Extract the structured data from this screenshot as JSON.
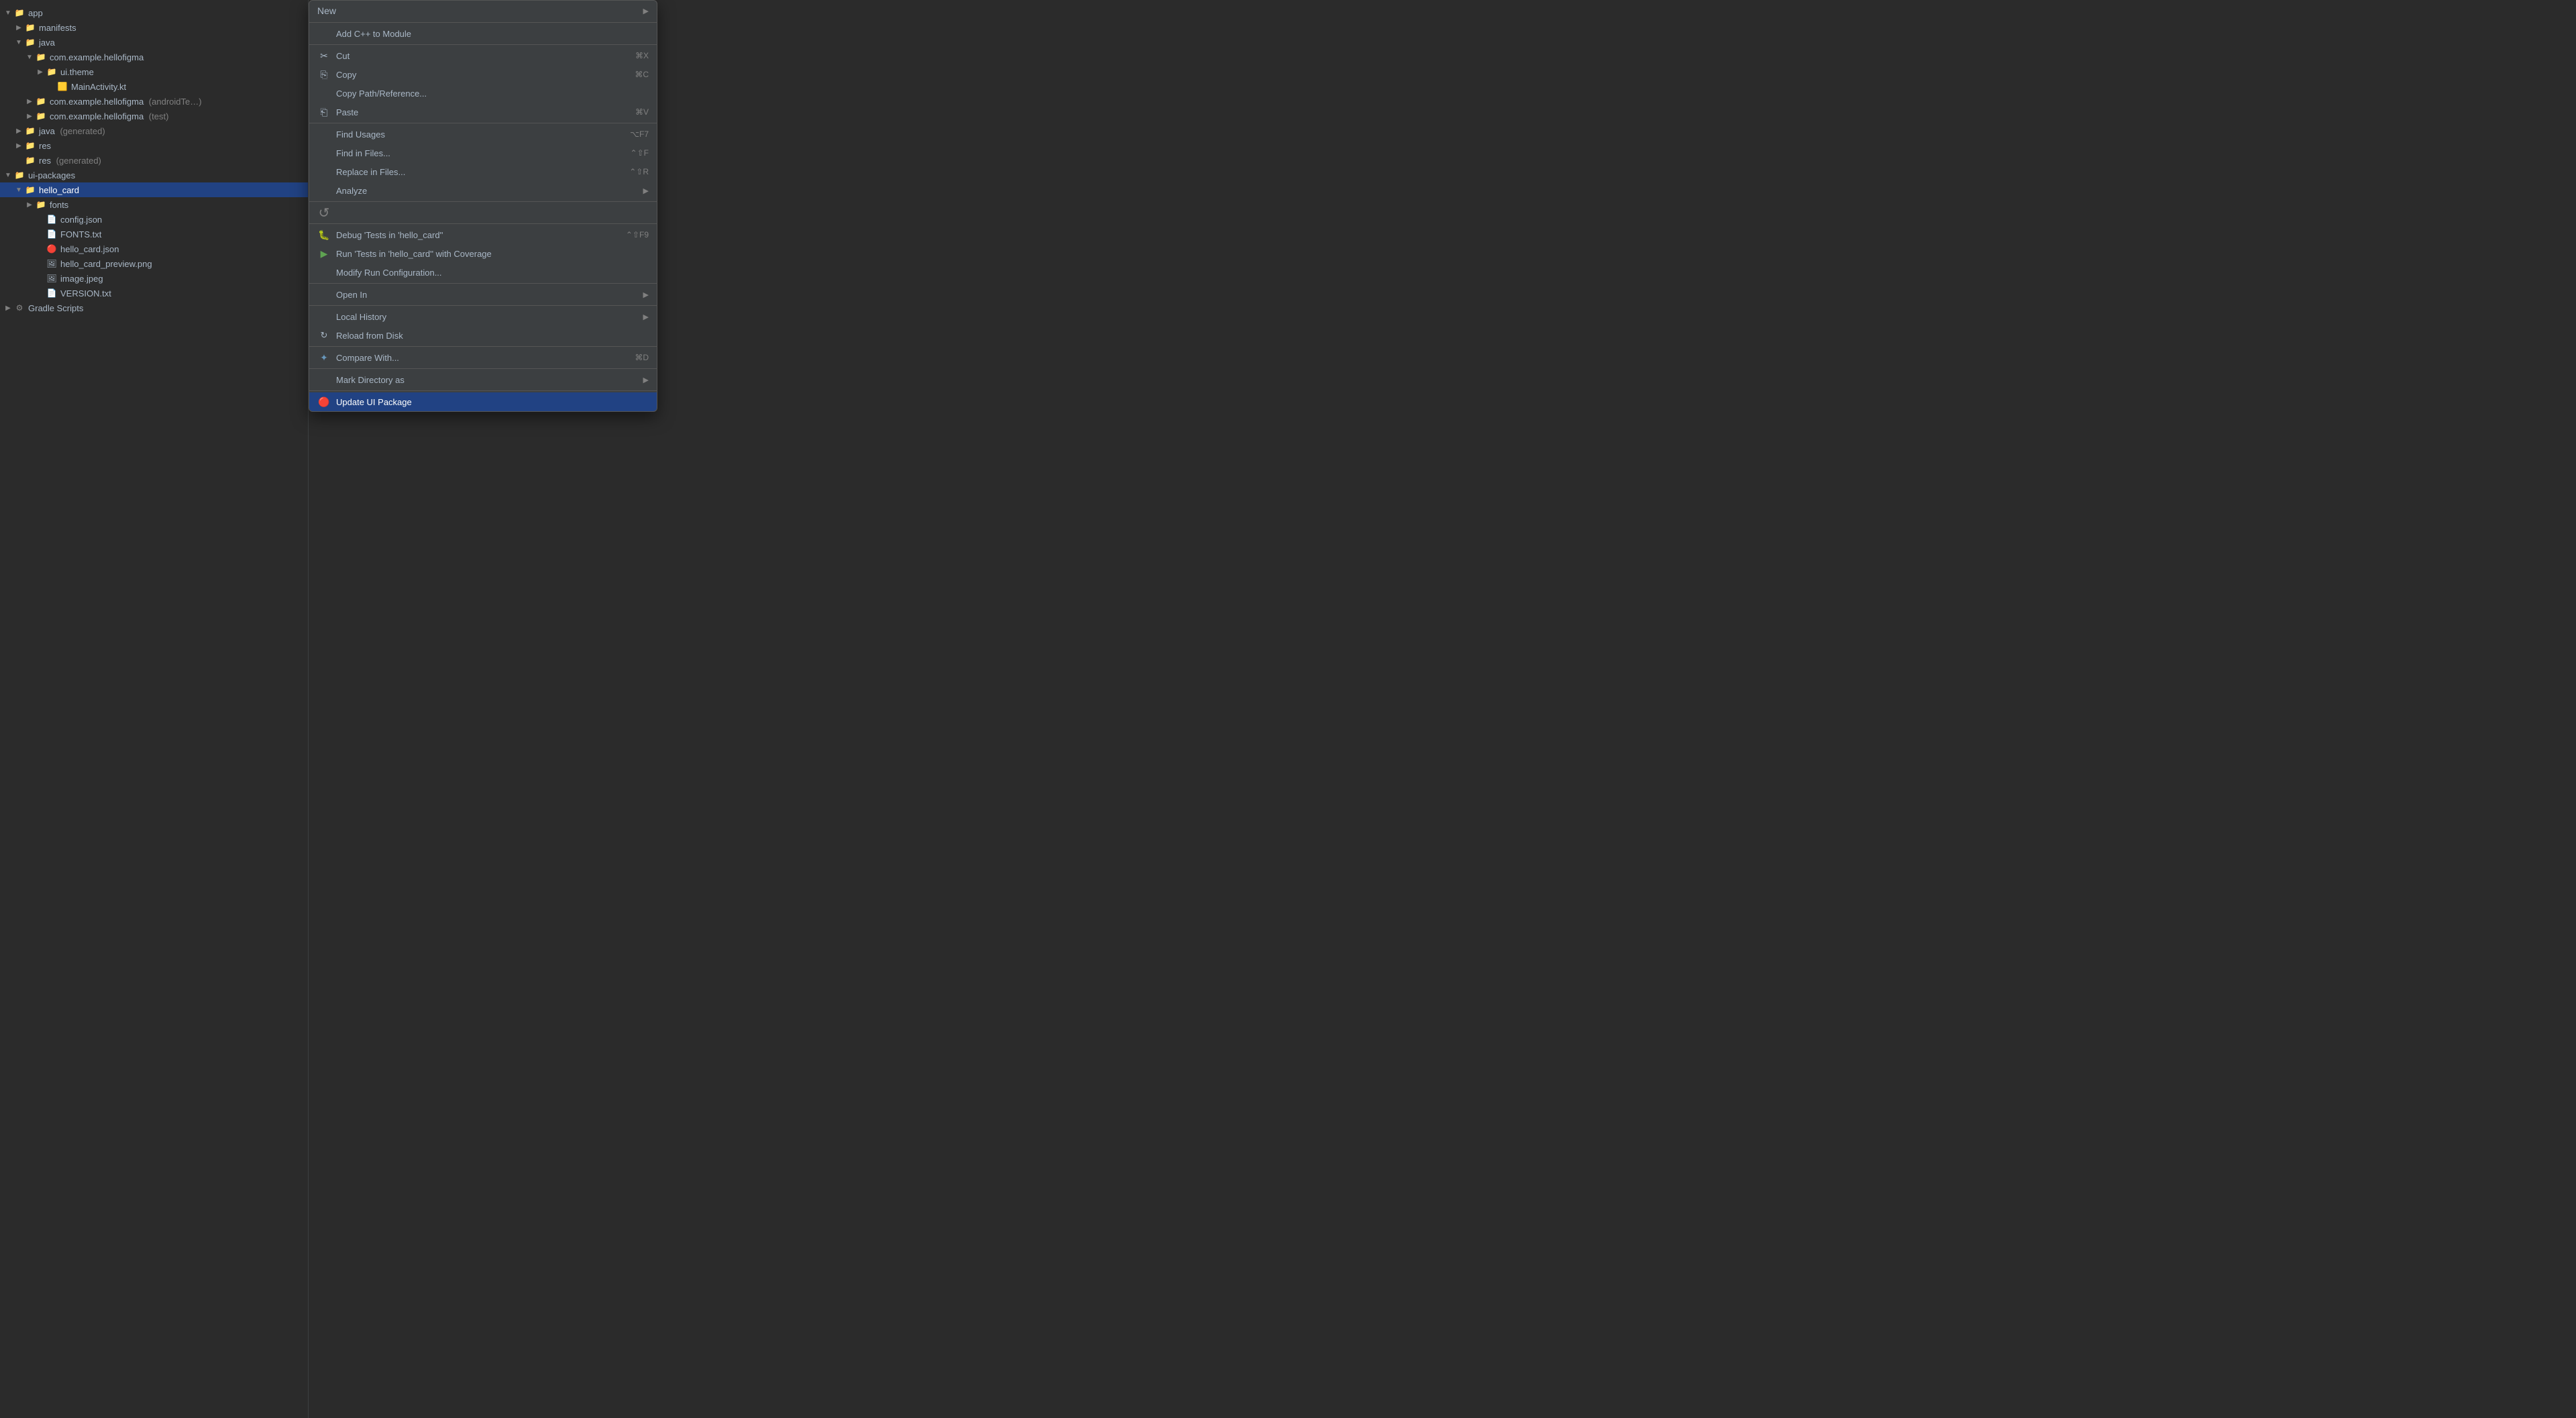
{
  "fileTree": {
    "items": [
      {
        "id": "app",
        "label": "app",
        "indent": 0,
        "type": "folder",
        "expanded": true,
        "chevron": "▼"
      },
      {
        "id": "manifests",
        "label": "manifests",
        "indent": 1,
        "type": "folder",
        "expanded": false,
        "chevron": "▶"
      },
      {
        "id": "java",
        "label": "java",
        "indent": 1,
        "type": "folder",
        "expanded": true,
        "chevron": "▼"
      },
      {
        "id": "com.example.hellofigma",
        "label": "com.example.hellofigma",
        "indent": 2,
        "type": "folder",
        "expanded": true,
        "chevron": "▼"
      },
      {
        "id": "ui.theme",
        "label": "ui.theme",
        "indent": 3,
        "type": "folder",
        "expanded": false,
        "chevron": "▶"
      },
      {
        "id": "MainActivity.kt",
        "label": "MainActivity.kt",
        "indent": 3,
        "type": "kotlin",
        "chevron": ""
      },
      {
        "id": "com.example.hellofigma.androidTest",
        "label": "com.example.hellofigma",
        "secondary": "(androidTe…)",
        "indent": 2,
        "type": "folder",
        "expanded": false,
        "chevron": "▶"
      },
      {
        "id": "com.example.hellofigma.test",
        "label": "com.example.hellofigma",
        "secondary": "(test)",
        "indent": 2,
        "type": "folder",
        "expanded": false,
        "chevron": "▶"
      },
      {
        "id": "java.generated",
        "label": "java",
        "secondary": "(generated)",
        "indent": 1,
        "type": "folder-special",
        "expanded": false,
        "chevron": "▶"
      },
      {
        "id": "res",
        "label": "res",
        "indent": 1,
        "type": "folder",
        "expanded": false,
        "chevron": "▶"
      },
      {
        "id": "res.generated",
        "label": "res",
        "secondary": "(generated)",
        "indent": 1,
        "type": "folder",
        "expanded": false,
        "chevron": ""
      },
      {
        "id": "ui-packages",
        "label": "ui-packages",
        "indent": 0,
        "type": "folder",
        "expanded": true,
        "chevron": "▼"
      },
      {
        "id": "hello_card",
        "label": "hello_card",
        "indent": 1,
        "type": "folder",
        "expanded": true,
        "chevron": "▼",
        "selected": true
      },
      {
        "id": "fonts",
        "label": "fonts",
        "indent": 2,
        "type": "folder",
        "expanded": false,
        "chevron": "▶"
      },
      {
        "id": "config.json",
        "label": "config.json",
        "indent": 2,
        "type": "json"
      },
      {
        "id": "FONTS.txt",
        "label": "FONTS.txt",
        "indent": 2,
        "type": "txt"
      },
      {
        "id": "hello_card.json",
        "label": "hello_card.json",
        "indent": 2,
        "type": "json-red"
      },
      {
        "id": "hello_card_preview.png",
        "label": "hello_card_preview.png",
        "indent": 2,
        "type": "image"
      },
      {
        "id": "image.jpeg",
        "label": "image.jpeg",
        "indent": 2,
        "type": "image"
      },
      {
        "id": "VERSION.txt",
        "label": "VERSION.txt",
        "indent": 2,
        "type": "txt"
      },
      {
        "id": "Gradle Scripts",
        "label": "Gradle Scripts",
        "indent": 0,
        "type": "gradle",
        "expanded": false,
        "chevron": "▶"
      }
    ]
  },
  "contextMenu": {
    "items": [
      {
        "id": "new",
        "label": "New",
        "hasArrow": true,
        "type": "submenu",
        "icon": ""
      },
      {
        "id": "separator1",
        "type": "separator"
      },
      {
        "id": "add-cpp",
        "label": "Add C++ to Module",
        "type": "action",
        "icon": ""
      },
      {
        "id": "separator2",
        "type": "separator"
      },
      {
        "id": "cut",
        "label": "Cut",
        "shortcut": "⌘X",
        "type": "action",
        "icon": "✂"
      },
      {
        "id": "copy",
        "label": "Copy",
        "shortcut": "⌘C",
        "type": "action",
        "icon": "⎘"
      },
      {
        "id": "copy-path",
        "label": "Copy Path/Reference...",
        "type": "action",
        "icon": ""
      },
      {
        "id": "paste",
        "label": "Paste",
        "shortcut": "⌘V",
        "type": "action",
        "icon": "⎗"
      },
      {
        "id": "separator3",
        "type": "separator"
      },
      {
        "id": "find-usages",
        "label": "Find Usages",
        "shortcut": "⌥F7",
        "type": "action",
        "icon": ""
      },
      {
        "id": "find-in-files",
        "label": "Find in Files...",
        "shortcut": "⌃⇧F",
        "type": "action",
        "icon": ""
      },
      {
        "id": "replace-in-files",
        "label": "Replace in Files...",
        "shortcut": "⌃⇧R",
        "type": "action",
        "icon": ""
      },
      {
        "id": "analyze",
        "label": "Analyze",
        "hasArrow": true,
        "type": "submenu",
        "icon": ""
      },
      {
        "id": "separator4",
        "type": "separator"
      },
      {
        "id": "spinner",
        "type": "spinner"
      },
      {
        "id": "separator5",
        "type": "separator"
      },
      {
        "id": "debug-tests",
        "label": "Debug 'Tests in 'hello_card''",
        "shortcut": "⌃⇧F9",
        "type": "action",
        "icon": "🐛"
      },
      {
        "id": "run-tests-coverage",
        "label": "Run 'Tests in 'hello_card'' with Coverage",
        "type": "action",
        "icon": "▶"
      },
      {
        "id": "modify-run",
        "label": "Modify Run Configuration...",
        "type": "action",
        "icon": ""
      },
      {
        "id": "separator6",
        "type": "separator"
      },
      {
        "id": "open-in",
        "label": "Open In",
        "hasArrow": true,
        "type": "submenu",
        "icon": ""
      },
      {
        "id": "separator7",
        "type": "separator"
      },
      {
        "id": "local-history",
        "label": "Local History",
        "hasArrow": true,
        "type": "submenu",
        "icon": ""
      },
      {
        "id": "reload-from-disk",
        "label": "Reload from Disk",
        "type": "action",
        "icon": "🔄"
      },
      {
        "id": "separator8",
        "type": "separator"
      },
      {
        "id": "compare-with",
        "label": "Compare With...",
        "shortcut": "⌘D",
        "type": "action",
        "icon": "✦"
      },
      {
        "id": "separator9",
        "type": "separator"
      },
      {
        "id": "mark-directory",
        "label": "Mark Directory as",
        "hasArrow": true,
        "type": "submenu",
        "icon": ""
      },
      {
        "id": "separator10",
        "type": "separator"
      },
      {
        "id": "update-ui-package",
        "label": "Update UI Package",
        "type": "action",
        "icon": "🔴",
        "highlighted": true
      }
    ]
  }
}
